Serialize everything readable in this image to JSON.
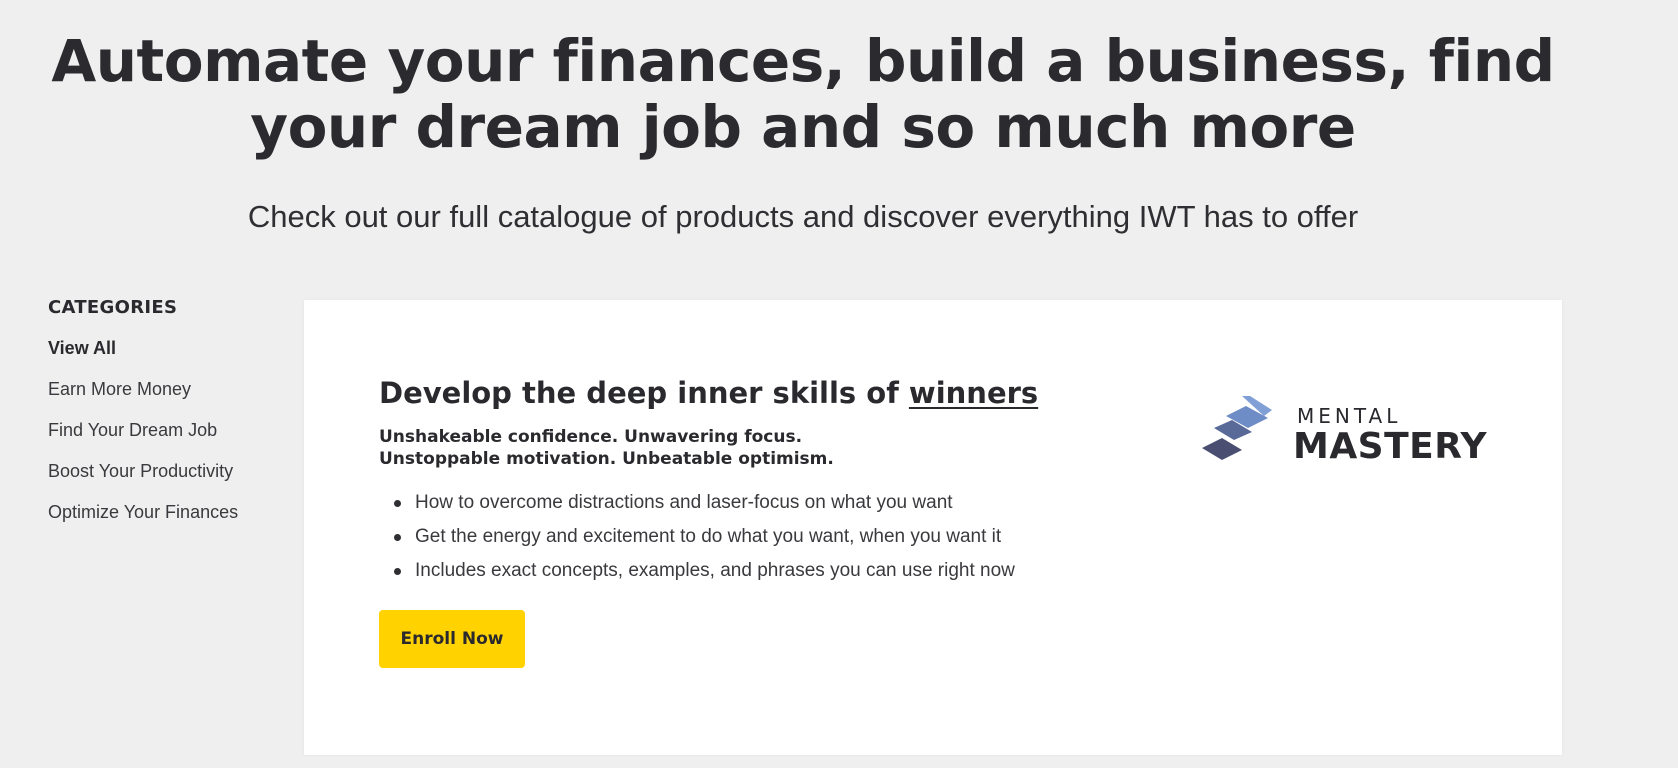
{
  "hero": {
    "title": "Automate your finances, build a business, find your dream job and so much more",
    "subtitle": "Check out our full catalogue of products and discover everything IWT has to offer"
  },
  "sidebar": {
    "heading": "CATEGORIES",
    "items": [
      {
        "label": "View All",
        "active": true
      },
      {
        "label": "Earn More Money",
        "active": false
      },
      {
        "label": "Find Your Dream Job",
        "active": false
      },
      {
        "label": "Boost Your Productivity",
        "active": false
      },
      {
        "label": "Optimize Your Finances",
        "active": false
      }
    ]
  },
  "product": {
    "title_prefix": "Develop the deep inner skills of ",
    "title_emphasis": "winners",
    "tagline_line1": "Unshakeable confidence. Unwavering focus.",
    "tagline_line2": "Unstoppable motivation. Unbeatable optimism.",
    "bullets": [
      "How to overcome distractions and laser-focus on what you want",
      "Get the energy and excitement to do what you want, when you want it",
      "Includes exact concepts, examples, and phrases you can use right now"
    ],
    "cta_label": "Enroll Now",
    "logo": {
      "small_text": "MENTAL",
      "big_text": "MASTERY",
      "icon": "stacked-stripes-logo-icon",
      "stripe_colors": [
        "#7f9fd6",
        "#6a7fb0",
        "#4a4f72"
      ]
    }
  },
  "colors": {
    "background": "#eeefee",
    "card": "#ffffff",
    "cta": "#ffd200",
    "text": "#2a2a2e"
  }
}
